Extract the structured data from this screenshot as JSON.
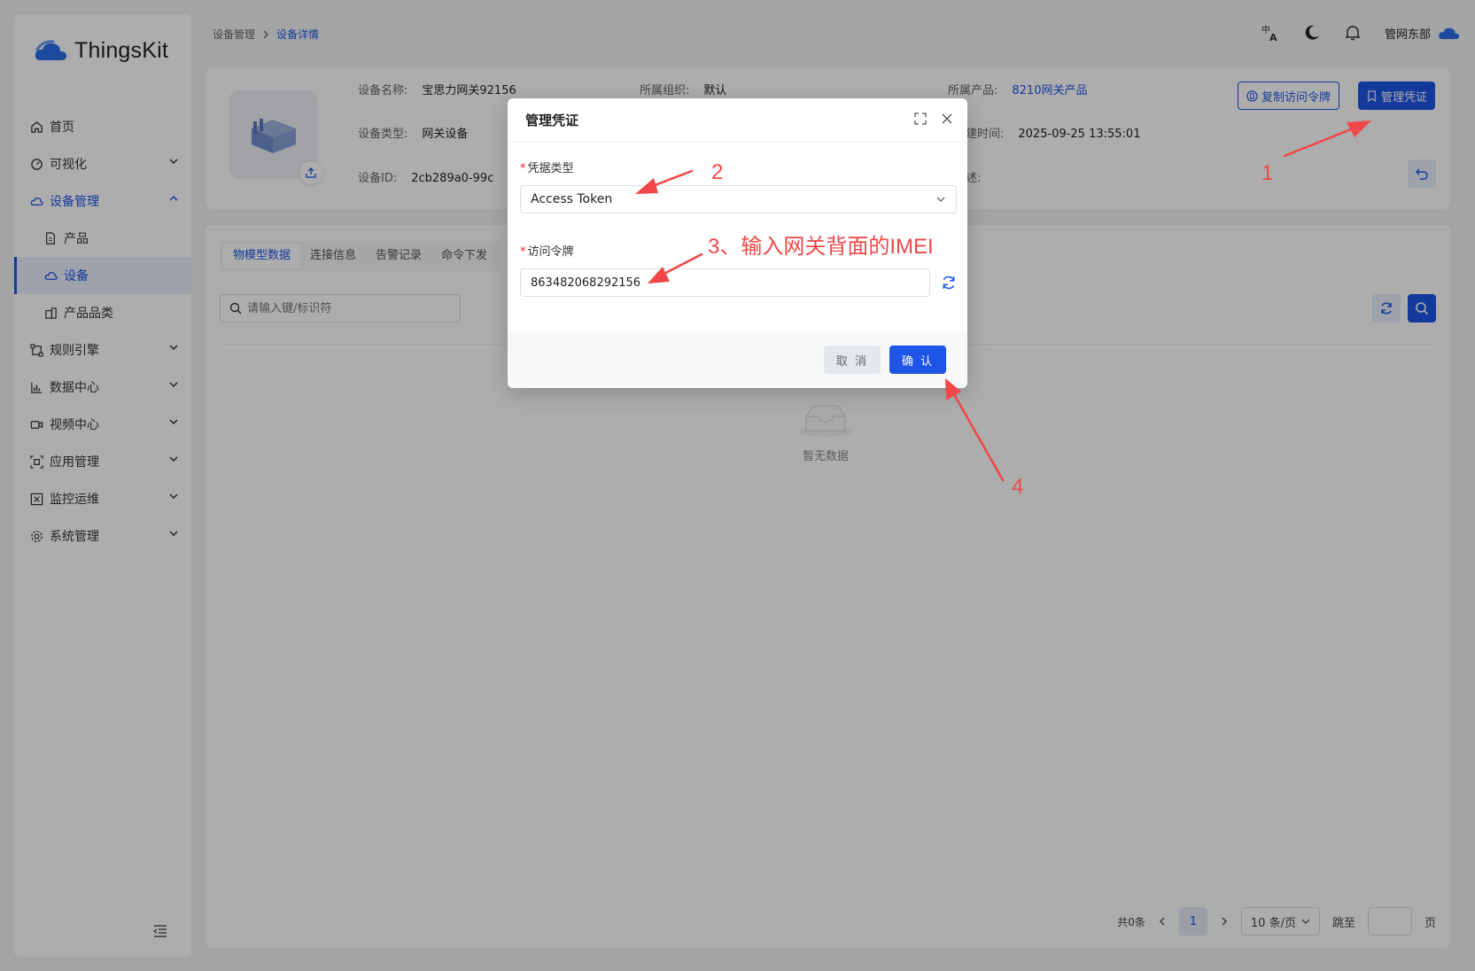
{
  "app": {
    "name": "ThingsKit"
  },
  "sidebar": {
    "items": [
      {
        "label": "首页",
        "icon": "home-icon"
      },
      {
        "label": "可视化",
        "icon": "dashboard-icon"
      },
      {
        "label": "设备管理",
        "icon": "cloud-icon"
      },
      {
        "label": "产品",
        "icon": "file-icon"
      },
      {
        "label": "设备",
        "icon": "cloud-icon"
      },
      {
        "label": "产品品类",
        "icon": "building-icon"
      },
      {
        "label": "规则引擎",
        "icon": "rule-icon"
      },
      {
        "label": "数据中心",
        "icon": "chart-icon"
      },
      {
        "label": "视频中心",
        "icon": "video-icon"
      },
      {
        "label": "应用管理",
        "icon": "app-icon"
      },
      {
        "label": "监控运维",
        "icon": "monitor-icon"
      },
      {
        "label": "系统管理",
        "icon": "gear-icon"
      }
    ]
  },
  "header": {
    "breadcrumb": [
      "设备管理",
      "设备详情"
    ],
    "user": "管网东部"
  },
  "device": {
    "name_label": "设备名称:",
    "name": "宝思力网关92156",
    "org_label": "所属组织:",
    "org": "默认",
    "product_label": "所属产品:",
    "product": "8210网关产品",
    "type_label": "设备类型:",
    "type": "网关设备",
    "created_label": "建时间:",
    "created": "2025-09-25 13:55:01",
    "id_label": "设备ID:",
    "id": "2cb289a0-99c",
    "extra_label": "述:",
    "copy_token_btn": "复制访问令牌",
    "manage_cred_btn": "管理凭证"
  },
  "tabs": [
    "物模型数据",
    "连接信息",
    "告警记录",
    "命令下发"
  ],
  "search": {
    "placeholder": "请输入键/标识符"
  },
  "empty_text": "暂无数据",
  "pager": {
    "total": "共0条",
    "page": "1",
    "size": "10 条/页",
    "jump": "跳至",
    "page_unit": "页"
  },
  "modal": {
    "title": "管理凭证",
    "cred_type_label": "凭据类型",
    "cred_type_value": "Access Token",
    "token_label": "访问令牌",
    "token_value": "863482068292156",
    "cancel": "取 消",
    "ok": "确 认"
  },
  "annotations": {
    "a1": "1",
    "a2": "2",
    "a3": "3、输入网关背面的IMEI",
    "a4": "4"
  },
  "colors": {
    "primary": "#1e55e6",
    "annotation": "#f04848",
    "required": "#f5222d"
  }
}
